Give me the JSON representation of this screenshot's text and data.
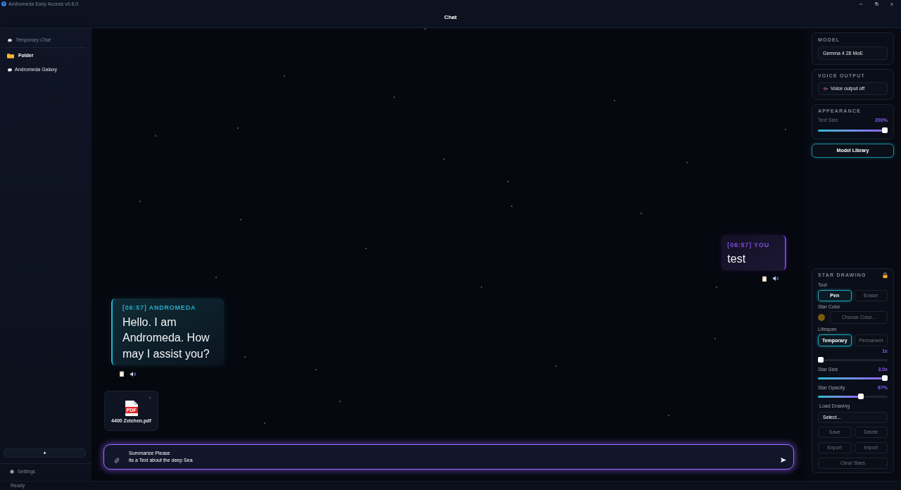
{
  "window": {
    "title": "Andromeda Early Access v0.6.0"
  },
  "header": {
    "title": "Chat"
  },
  "sidebar": {
    "items": [
      {
        "kind": "temporary",
        "label": "Temporary Chat"
      },
      {
        "kind": "folder",
        "label": "Folder"
      },
      {
        "kind": "chat",
        "label": "Andromeda Galaxy"
      }
    ],
    "new_button": "+",
    "settings": "Settings"
  },
  "chat": {
    "messages": [
      {
        "kind": "user",
        "header": "[06:57] YOU",
        "text": "test"
      },
      {
        "kind": "assistant",
        "header": "[06:57] ANDROMEDA",
        "text": "Hello. I am Andromeda. How may I assist you?"
      }
    ],
    "attachments": [
      {
        "name": "4400 Zeichen.pdf",
        "file_type": "PDF"
      }
    ],
    "composer": {
      "value": "Summarize Please\nits a Text about the deep Sea"
    }
  },
  "right_panel": {
    "model": {
      "heading": "MODEL",
      "value": "Gemma 4 28 MoE"
    },
    "voice_output": {
      "heading": "VOICE OUTPUT",
      "label": "Voice output off",
      "on": false
    },
    "appearance": {
      "heading": "APPEARANCE",
      "text_size": {
        "label": "Text Size",
        "reading": "200%",
        "level": 1
      }
    },
    "model_library_button": "Model Library",
    "star_drawing": {
      "heading": "STAR DRAWING",
      "locked": true,
      "tool": {
        "label": "Tool",
        "options": [
          {
            "label": "Pen",
            "selected": true
          },
          {
            "label": "Eraser",
            "selected": false
          }
        ]
      },
      "star_color": {
        "label": "Star Color",
        "color": "#7a5a0e",
        "button": "Choose Color..."
      },
      "lifespan": {
        "label": "Lifespan",
        "options": [
          {
            "label": "Temporary",
            "selected": true
          },
          {
            "label": "Permanent",
            "selected": false
          }
        ],
        "reading": "1s",
        "level": 0
      },
      "sliders": [
        {
          "label": "Star Size",
          "reading": "3.0x",
          "level": 1
        },
        {
          "label": "Star Opacity",
          "reading": "67%",
          "level": 0.63
        }
      ],
      "load_drawing": {
        "label": "Load Drawing",
        "value": "Select..."
      },
      "buttons": [
        "Save",
        "Delete",
        "Export",
        "Import",
        "Clear Stars"
      ]
    }
  },
  "status_bar": {
    "text": "Ready"
  }
}
